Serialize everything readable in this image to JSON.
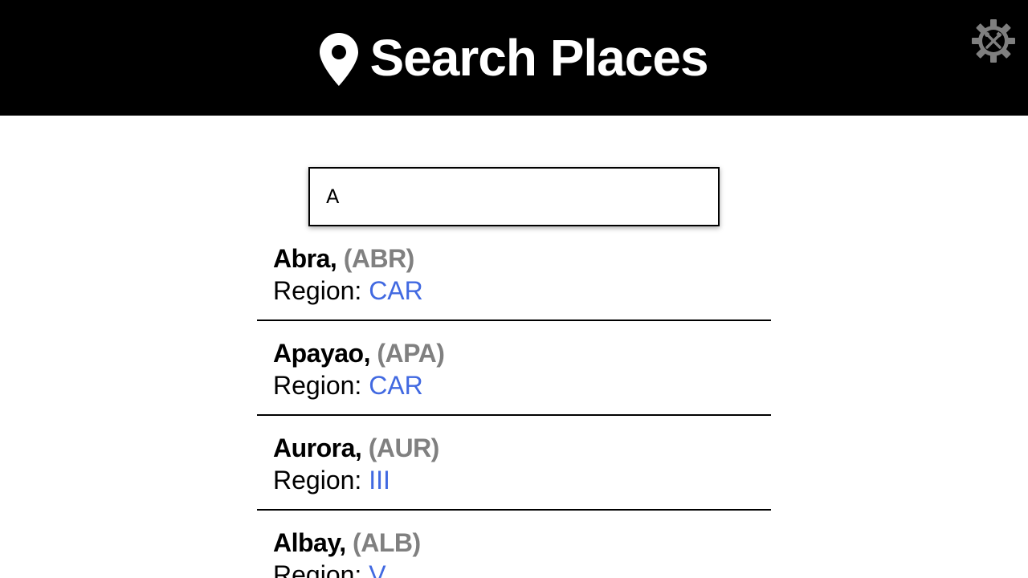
{
  "header": {
    "title": "Search Places",
    "icon": "map-pin-icon",
    "background": "#000000",
    "title_color": "#ffffff"
  },
  "settings": {
    "icon": "gear-tools-icon",
    "color": "#7f7f7f"
  },
  "search": {
    "value": "A",
    "placeholder": ""
  },
  "results": [
    {
      "name": "Abra,",
      "code": "(ABR)",
      "region_label": "Region: ",
      "region": "CAR"
    },
    {
      "name": "Apayao,",
      "code": "(APA)",
      "region_label": "Region: ",
      "region": "CAR"
    },
    {
      "name": "Aurora,",
      "code": "(AUR)",
      "region_label": "Region: ",
      "region": "III"
    },
    {
      "name": "Albay,",
      "code": "(ALB)",
      "region_label": "Region: ",
      "region": "V"
    }
  ],
  "colors": {
    "code": "#808080",
    "region": "#4169e1",
    "divider": "#000000"
  }
}
